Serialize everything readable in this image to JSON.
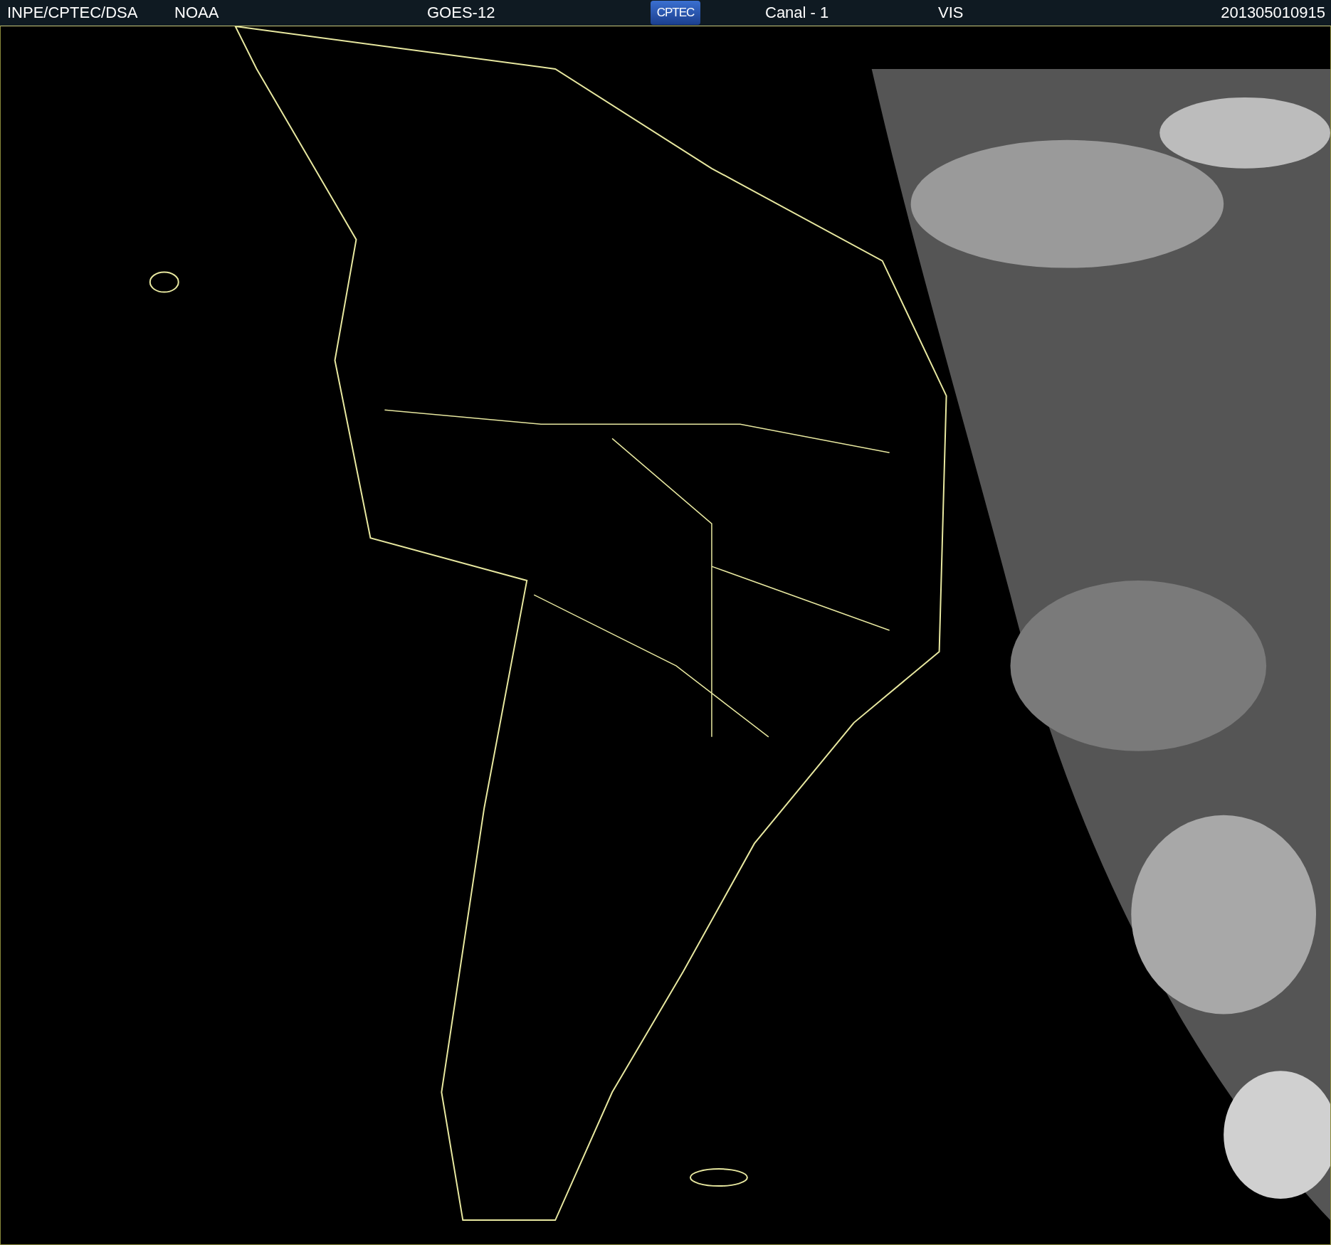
{
  "header": {
    "items": [
      {
        "kind": "text",
        "text": "INPE/CPTEC/DSA"
      },
      {
        "kind": "text",
        "text": "NOAA"
      },
      {
        "kind": "text",
        "text": "GOES-12"
      },
      {
        "kind": "logo",
        "text": "CPTEC"
      },
      {
        "kind": "text",
        "text": "Canal - 1"
      },
      {
        "kind": "text",
        "text": "VIS"
      },
      {
        "kind": "text",
        "text": "201305010915"
      }
    ]
  }
}
